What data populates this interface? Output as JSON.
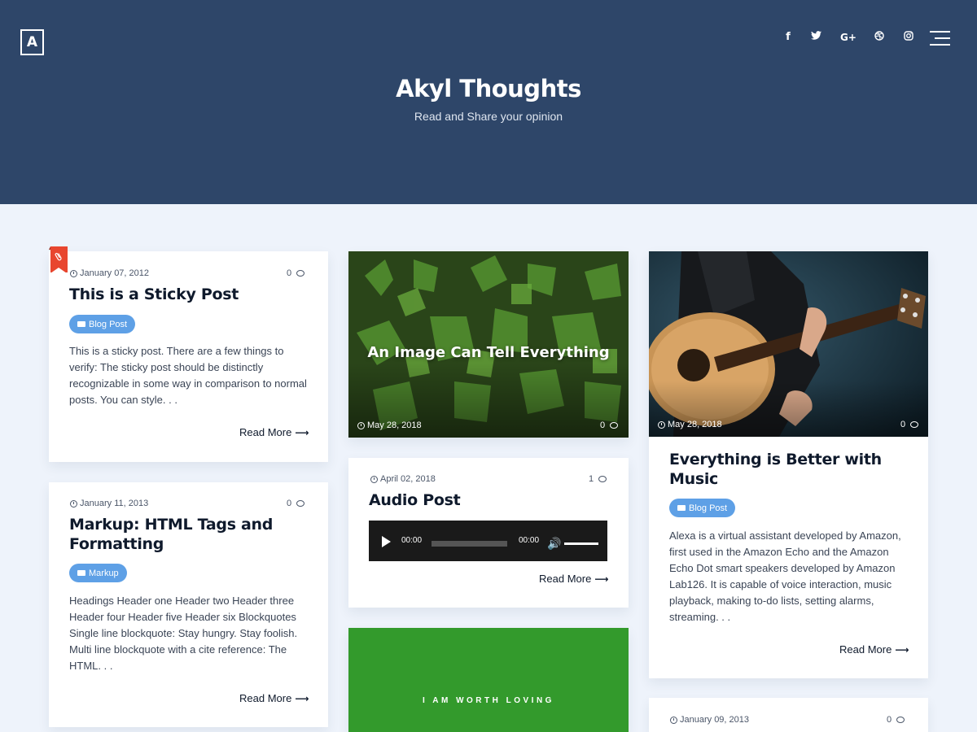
{
  "header": {
    "logo_letter": "A",
    "site_title": "Akyl Thoughts",
    "tagline": "Read and Share your opinion",
    "social": [
      {
        "icon": "facebook-icon",
        "glyph": "f"
      },
      {
        "icon": "twitter-icon",
        "glyph": "🐦"
      },
      {
        "icon": "google-plus-icon",
        "glyph": "G+"
      },
      {
        "icon": "dribbble-icon",
        "glyph": "⊕"
      },
      {
        "icon": "instagram-icon",
        "glyph": "◎"
      }
    ],
    "menu_icon": "hamburger-menu-icon"
  },
  "posts": {
    "sticky": {
      "date": "January 07, 2012",
      "comments": "0",
      "title": "This is a Sticky Post",
      "category": "Blog Post",
      "excerpt": "This is a sticky post. There are a few things to verify: The sticky post should be distinctly recognizable in some way in comparison to normal posts. You can style. . .",
      "read_more": "Read More"
    },
    "markup": {
      "date": "January 11, 2013",
      "comments": "0",
      "title": "Markup: HTML Tags and Formatting",
      "category": "Markup",
      "excerpt": "Headings Header one Header two Header three Header four Header five Header six Blockquotes Single line blockquote: Stay hungry. Stay foolish. Multi line blockquote with a cite reference: The HTML. . .",
      "read_more": "Read More"
    },
    "image": {
      "title": "An Image Can Tell Everything",
      "date": "May 28, 2018",
      "comments": "0"
    },
    "audio": {
      "date": "April 02, 2018",
      "comments": "1",
      "title": "Audio Post",
      "time_current": "00:00",
      "time_total": "00:00",
      "read_more": "Read More"
    },
    "green": {
      "text": "I AM WORTH LOVING"
    },
    "music": {
      "date": "May 28, 2018",
      "comments": "0",
      "title": "Everything is Better with Music",
      "category": "Blog Post",
      "excerpt": "Alexa is a virtual assistant developed by Amazon, first used in the Amazon Echo and the Amazon Echo Dot smart speakers developed by Amazon Lab126. It is capable of voice interaction, music playback, making to-do lists, setting alarms, streaming. . .",
      "read_more": "Read More"
    },
    "bottom": {
      "date": "January 09, 2013",
      "comments": "0"
    }
  },
  "colors": {
    "header_bg": "#2e4669",
    "page_bg": "#eef3fb",
    "category_badge": "#5ea0e6",
    "sticky_ribbon": "#e8462f",
    "green_card": "#339a2c"
  }
}
